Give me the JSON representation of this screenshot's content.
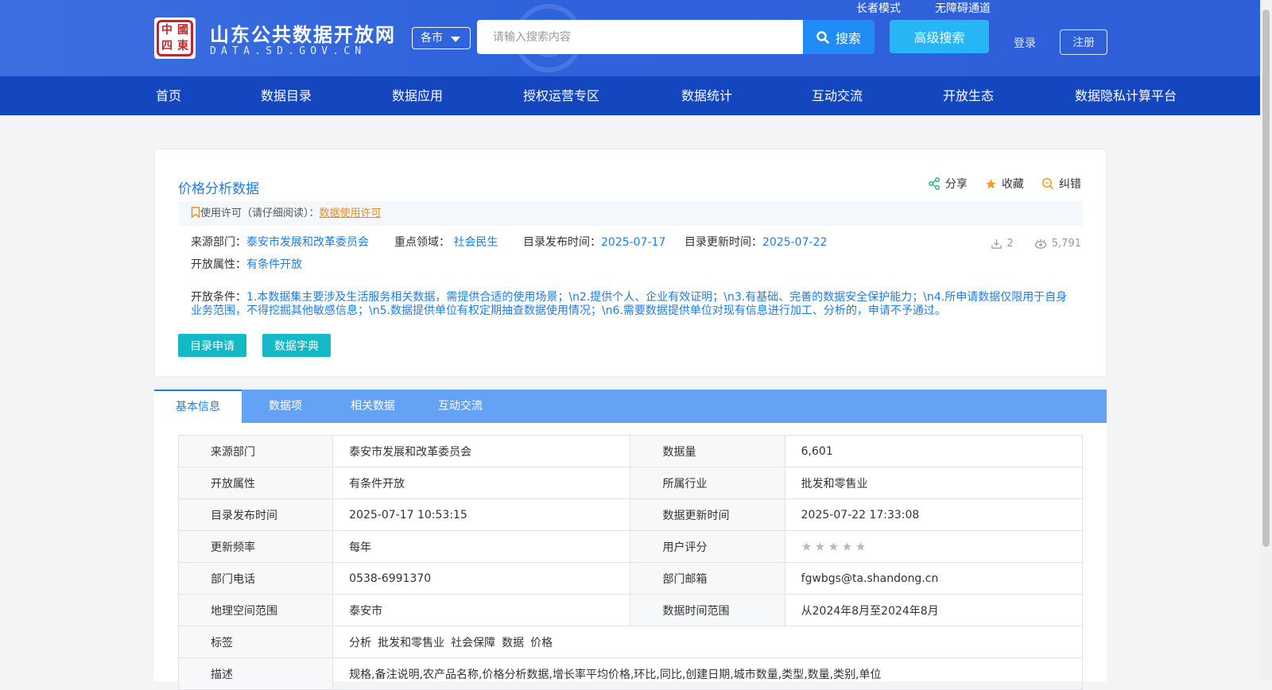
{
  "header": {
    "logo_seal_chars": [
      "中",
      "國",
      "四",
      "東"
    ],
    "site_title": "山东公共数据开放网",
    "site_domain": "DATA.SD.GOV.CN",
    "elder_mode": "长者模式",
    "accessibility": "无障碍通道",
    "city_select": "各市",
    "search_placeholder": "请输入搜索内容",
    "search_button": "搜索",
    "advanced_search": "高级搜索",
    "login": "登录",
    "register": "注册"
  },
  "nav": [
    "首页",
    "数据目录",
    "数据应用",
    "授权运营专区",
    "数据统计",
    "互动交流",
    "开放生态",
    "数据隐私计算平台"
  ],
  "dataset": {
    "title": "价格分析数据",
    "actions": {
      "share": "分享",
      "favorite": "收藏",
      "report": "纠错"
    },
    "license_label": "使用许可（请仔细阅读）：",
    "license_link": "数据使用许可",
    "source_label": "来源部门：",
    "source_value": "泰安市发展和改革委员会",
    "domain_label": "重点领域：",
    "domain_value": "社会民生",
    "publish_label": "目录发布时间：",
    "publish_value": "2025-07-17",
    "update_label": "目录更新时间：",
    "update_value": "2025-07-22",
    "downloads": "2",
    "views": "5,791",
    "open_label": "开放属性：",
    "open_value": "有条件开放",
    "conditions_label": "开放条件：",
    "conditions_value": "1.本数据集主要涉及生活服务相关数据，需提供合适的使用场景；\\n2.提供个人、企业有效证明；\\n3.有基础、完善的数据安全保护能力；\\n4.所申请数据仅限用于自身业务范围，不得挖掘其他敏感信息；\\n5.数据提供单位有权定期抽查数据使用情况；\\n6.需要数据提供单位对现有信息进行加工、分析的，申请不予通过。",
    "apply_button": "目录申请",
    "dictionary_button": "数据字典"
  },
  "tabs": [
    "基本信息",
    "数据项",
    "相关数据",
    "互动交流"
  ],
  "info": {
    "rows": [
      {
        "l1": "来源部门",
        "v1": "泰安市发展和改革委员会",
        "l2": "数据量",
        "v2": "6,601"
      },
      {
        "l1": "开放属性",
        "v1": "有条件开放",
        "l2": "所属行业",
        "v2": "批发和零售业"
      },
      {
        "l1": "目录发布时间",
        "v1": "2025-07-17 10:53:15",
        "l2": "数据更新时间",
        "v2": "2025-07-22 17:33:08"
      },
      {
        "l1": "更新频率",
        "v1": "每年",
        "l2": "用户评分",
        "v2": ""
      },
      {
        "l1": "部门电话",
        "v1": "0538-6991370",
        "l2": "部门邮箱",
        "v2": "fgwbgs@ta.shandong.cn"
      },
      {
        "l1": "地理空间范围",
        "v1": "泰安市",
        "l2": "数据时间范围",
        "v2": "从2024年8月至2024年8月"
      }
    ],
    "rating": 0,
    "rating_max": 5,
    "tags_label": "标签",
    "tags": [
      "分析",
      "批发和零售业",
      "社会保障",
      "数据",
      "价格"
    ],
    "desc_label": "描述",
    "desc_value": "规格,备注说明,农产品名称,价格分析数据,增长率平均价格,环比,同比,创建日期,城市数量,类型,数量,类别,单位"
  },
  "colors": {
    "brand_blue": "#1446c0",
    "link_blue": "#1f7de3",
    "teal": "#15b8c5",
    "orange": "#f08a1d"
  }
}
